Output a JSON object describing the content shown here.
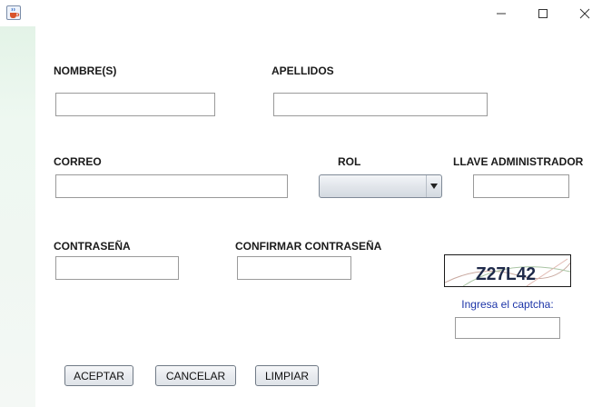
{
  "window": {
    "app_icon": "java-cup-icon",
    "controls": [
      "minimize-icon",
      "maximize-icon",
      "close-icon"
    ]
  },
  "form": {
    "nombres_label": "NOMBRE(S)",
    "nombres_value": "",
    "apellidos_label": "APELLIDOS",
    "apellidos_value": "",
    "correo_label": "CORREO",
    "correo_value": "",
    "rol_label": "ROL",
    "rol_selected": "",
    "llave_label": "LLAVE ADMINISTRADOR",
    "llave_value": "",
    "contrasena_label": "CONTRASEÑA",
    "contrasena_value": "",
    "confirmar_label": "CONFIRMAR CONTRASEÑA",
    "confirmar_value": ""
  },
  "captcha": {
    "image_text": "Z27L42",
    "prompt": "Ingresa el captcha:",
    "input_value": ""
  },
  "buttons": {
    "accept": "ACEPTAR",
    "cancel": "CANCELAR",
    "clear": "LIMPIAR"
  },
  "colors": {
    "side_strip": "#e8f5ec",
    "captcha_prompt": "#1d35a8",
    "field_border": "#9a9a9a"
  }
}
